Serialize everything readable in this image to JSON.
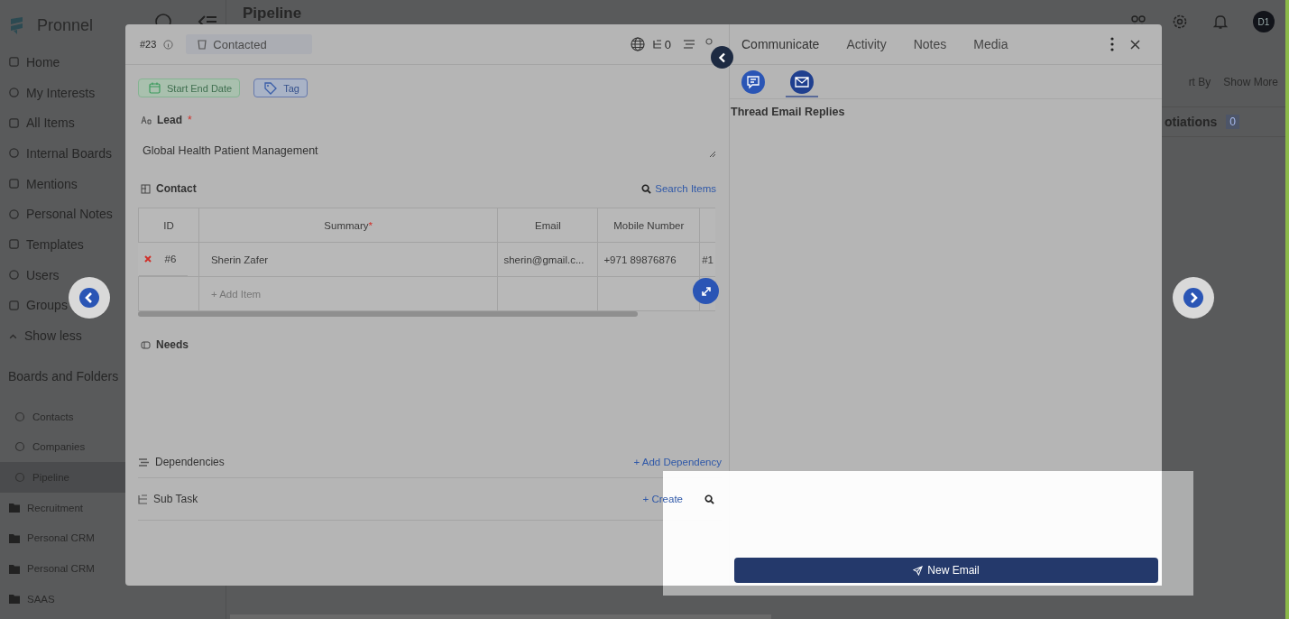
{
  "app": {
    "logo": "Pronnel",
    "page_title": "Pipeline",
    "avatar": "D1"
  },
  "sidebar": {
    "items": [
      {
        "label": "Home"
      },
      {
        "label": "My Interests"
      },
      {
        "label": "All Items"
      },
      {
        "label": "Internal Boards"
      },
      {
        "label": "Mentions"
      },
      {
        "label": "Personal Notes"
      },
      {
        "label": "Templates"
      },
      {
        "label": "Users"
      },
      {
        "label": "Groups"
      }
    ],
    "show_less": "Show less",
    "section": "Boards and Folders",
    "boards": [
      {
        "label": "Contacts",
        "kind": "board",
        "selected": false
      },
      {
        "label": "Companies",
        "kind": "board",
        "selected": false
      },
      {
        "label": "Pipeline",
        "kind": "board",
        "selected": true
      },
      {
        "label": "Recruitment",
        "kind": "folder",
        "selected": false
      },
      {
        "label": "Personal CRM",
        "kind": "folder",
        "selected": false
      },
      {
        "label": "Personal CRM",
        "kind": "folder",
        "selected": false
      },
      {
        "label": "SAAS",
        "kind": "folder",
        "selected": false
      }
    ]
  },
  "board_toolbar": {
    "sort": "rt By",
    "show_more": "Show More",
    "column": "otiations",
    "count": "0"
  },
  "modal": {
    "item_id": "#23",
    "status": "Contacted",
    "header_count": "0",
    "chips": [
      {
        "label": "Start End Date",
        "kind": "date"
      },
      {
        "label": "Tag",
        "kind": "tag"
      }
    ],
    "lead": {
      "label": "Lead",
      "required_mark": "*",
      "value": "Global Health Patient Management"
    },
    "contact": {
      "label": "Contact",
      "search": "Search Items",
      "columns": [
        {
          "label": "ID"
        },
        {
          "label": "Summary",
          "required_mark": "*"
        },
        {
          "label": "Email"
        },
        {
          "label": "Mobile Number"
        }
      ],
      "rows": [
        {
          "cells": [
            "#6",
            "Sherin Zafer",
            "sherin@gmail.c...",
            "+971 89876876",
            "#1"
          ]
        }
      ],
      "add_item": "+ Add Item"
    },
    "needs": "Needs",
    "dependencies": {
      "label": "Dependencies",
      "action": "+ Add Dependency"
    },
    "sub_task": {
      "label": "Sub Task",
      "action": "+ Create"
    }
  },
  "panel": {
    "tabs": [
      {
        "label": "Communicate",
        "selected": true
      },
      {
        "label": "Activity",
        "selected": false
      },
      {
        "label": "Notes",
        "selected": false
      },
      {
        "label": "Media",
        "selected": false
      }
    ],
    "sub_tabs": [
      {
        "kind": "chat",
        "selected": false
      },
      {
        "kind": "email",
        "selected": true
      }
    ],
    "section_title": "Thread Email Replies",
    "new_email": "New Email"
  }
}
